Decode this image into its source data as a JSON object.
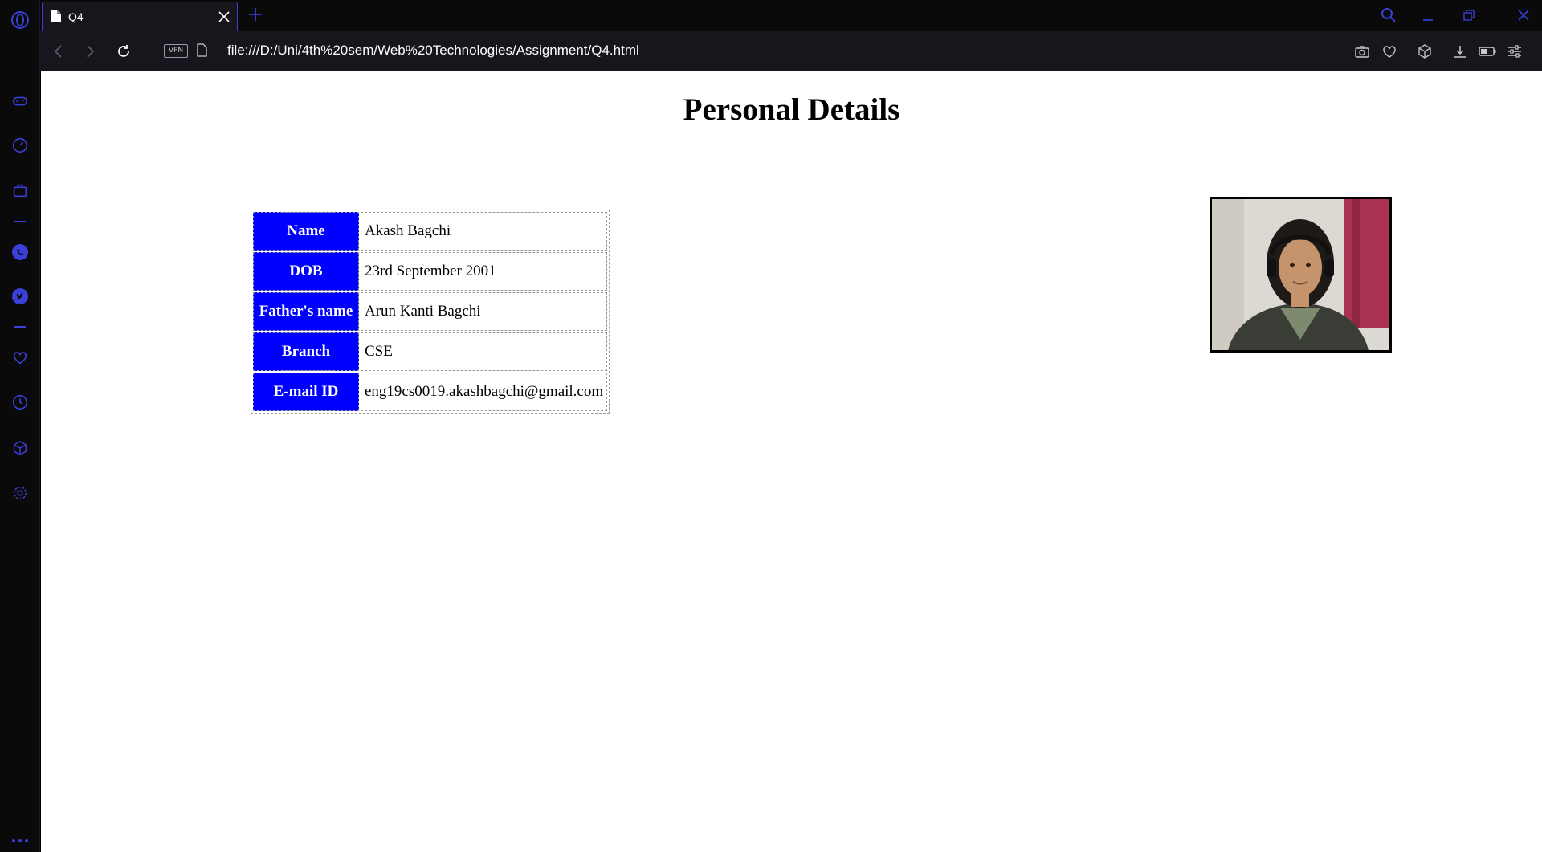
{
  "browser": {
    "tab": {
      "title": "Q4"
    },
    "address": {
      "vpn_label": "VPN",
      "url": "file:///D:/Uni/4th%20sem/Web%20Technologies/Assignment/Q4.html"
    }
  },
  "page": {
    "heading": "Personal Details",
    "details": [
      {
        "label": "Name",
        "value": "Akash Bagchi"
      },
      {
        "label": "DOB",
        "value": "23rd September 2001"
      },
      {
        "label": "Father's name",
        "value": "Arun Kanti Bagchi"
      },
      {
        "label": "Branch",
        "value": "CSE"
      },
      {
        "label": "E-mail ID",
        "value": "eng19cs0019.akashbagchi@gmail.com"
      }
    ]
  },
  "colors": {
    "accent": "#3a3fd8",
    "label_bg": "#0000ff"
  },
  "icons": {
    "sidebar": [
      "opera-logo-icon",
      "gamepad-icon",
      "speedometer-icon",
      "bag-icon",
      "whatsapp-icon",
      "twitter-icon",
      "heart-icon",
      "history-icon",
      "cube-icon",
      "settings-icon",
      "more-icon"
    ],
    "toolbar": [
      "back-icon",
      "forward-icon",
      "reload-icon",
      "camera-icon",
      "heart-icon",
      "cube-icon",
      "download-icon",
      "battery-icon",
      "easy-setup-icon"
    ]
  }
}
